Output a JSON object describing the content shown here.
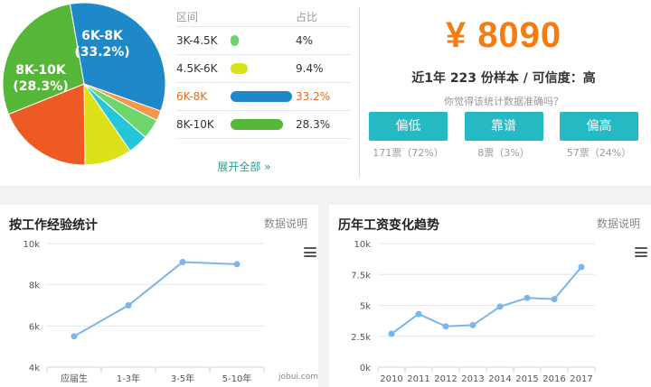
{
  "distribution": {
    "header": {
      "range": "区间",
      "share": "占比"
    },
    "rows": [
      {
        "range": "3K-4.5K",
        "share": "4%",
        "value": 4,
        "color": "#6dd66a"
      },
      {
        "range": "4.5K-6K",
        "share": "9.4%",
        "value": 9.4,
        "color": "#dbe21a"
      },
      {
        "range": "6K-8K",
        "share": "33.2%",
        "value": 33.2,
        "color": "#1e88c8",
        "highlight": true
      },
      {
        "range": "8K-10K",
        "share": "28.3%",
        "value": 28.3,
        "color": "#55b637"
      }
    ],
    "expand_label": "展开全部 »"
  },
  "pie_labels": [
    {
      "name": "6K-8K",
      "pct": "(33.2%)"
    },
    {
      "name": "8K-10K",
      "pct": "(28.3%)"
    }
  ],
  "salary": {
    "amount": "¥ 8090",
    "summary": "近1年 223 份样本 / 可信度：高",
    "question": "你觉得该统计数据准确吗？",
    "votes": [
      {
        "label": "偏低",
        "count": "171票（72%）"
      },
      {
        "label": "靠谱",
        "count": "8票（3%）"
      },
      {
        "label": "偏高",
        "count": "57票（24%）"
      }
    ]
  },
  "experience_panel": {
    "title": "按工作经验统计",
    "note": "数据说明",
    "watermark": "jobui.com"
  },
  "trend_panel": {
    "title": "历年工资变化趋势",
    "note": "数据说明"
  },
  "chart_data": [
    {
      "type": "pie",
      "labels": [
        "6K-8K",
        "8K-10K"
      ],
      "values": [
        33.2,
        28.3
      ],
      "slices": [
        {
          "value": 33.2,
          "color": "#1e88c8"
        },
        {
          "value": 2,
          "color": "#f5964a"
        },
        {
          "value": 4,
          "color": "#6dd66a"
        },
        {
          "value": 4,
          "color": "#26c6da"
        },
        {
          "value": 9.4,
          "color": "#dbe21a"
        },
        {
          "value": 19.1,
          "color": "#ee5a24"
        },
        {
          "value": 28.3,
          "color": "#55b637"
        }
      ]
    },
    {
      "type": "line",
      "title": "按工作经验统计",
      "categories": [
        "应届生",
        "1-3年",
        "3-5年",
        "5-10年"
      ],
      "values": [
        5500,
        7000,
        9100,
        9000
      ],
      "yticks": [
        "4k",
        "6k",
        "8k",
        "10k"
      ],
      "ylim": [
        4000,
        10000
      ],
      "color": "#7cb5ec"
    },
    {
      "type": "line",
      "title": "历年工资变化趋势",
      "categories": [
        "2010",
        "2011",
        "2012",
        "2013",
        "2014",
        "2015",
        "2016",
        "2017"
      ],
      "values": [
        2700,
        4300,
        3300,
        3400,
        4900,
        5600,
        5500,
        8100
      ],
      "yticks": [
        "0k",
        "2.5k",
        "5k",
        "7.5k",
        "10k"
      ],
      "ylim": [
        0,
        10000
      ],
      "color": "#7cb5ec"
    }
  ]
}
